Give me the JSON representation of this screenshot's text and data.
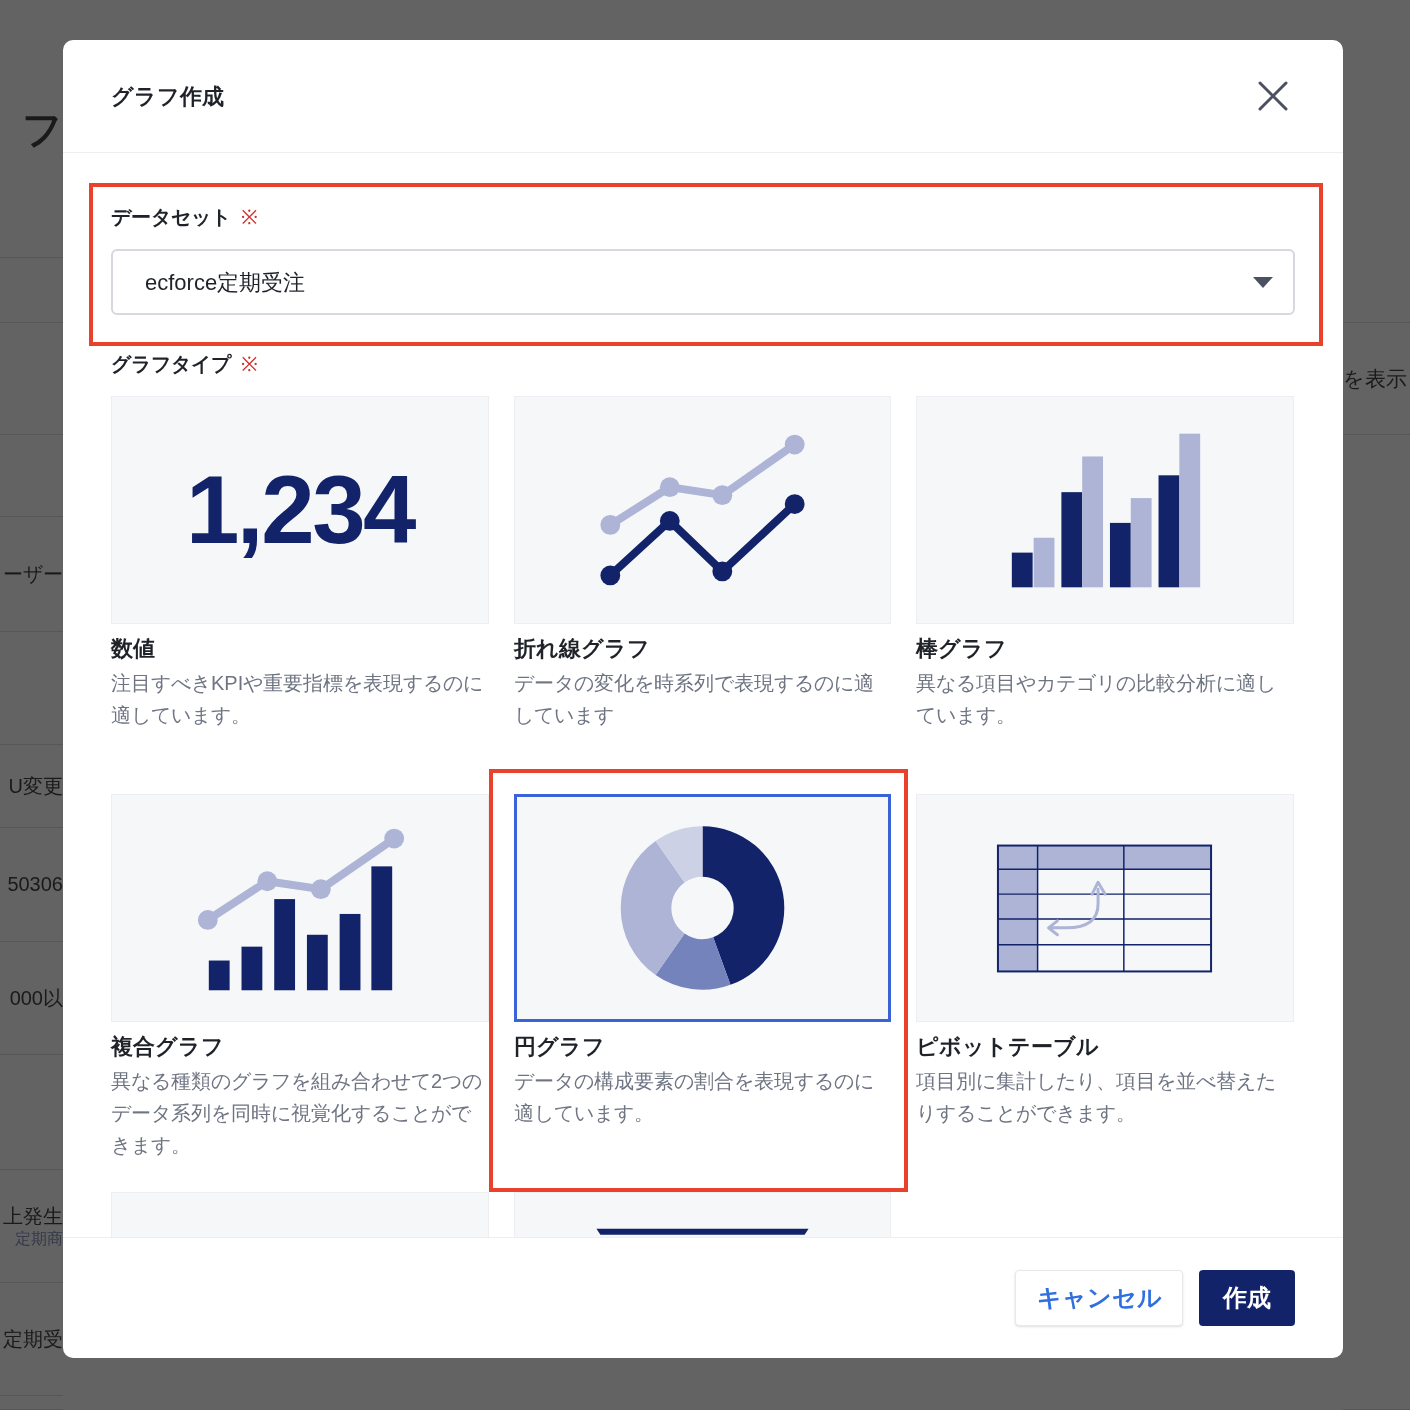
{
  "background": {
    "left": [
      {
        "text": "フ"
      },
      {
        "text": "ーザー"
      },
      {
        "text": "U変更"
      },
      {
        "text": "50306"
      },
      {
        "text": "000以"
      },
      {
        "text": "上発生",
        "subtext": "定期商"
      },
      {
        "text": "定期受"
      }
    ],
    "right": [
      "を表示"
    ]
  },
  "dialog": {
    "title": "グラフ作成"
  },
  "dataset": {
    "label": "データセット",
    "required_mark": "※",
    "value": "ecforce定期受注",
    "highlighted": true
  },
  "graph_type": {
    "label": "グラフタイプ",
    "required_mark": "※"
  },
  "cards": [
    {
      "kind": "number",
      "figure_text": "1,234",
      "title": "数値",
      "description": "注目すべきKPIや重要指標を表現するのに適しています。",
      "selected": false,
      "highlighted": false
    },
    {
      "kind": "line",
      "title": "折れ線グラフ",
      "description": "データの変化を時系列で表現するのに適しています",
      "selected": false,
      "highlighted": false
    },
    {
      "kind": "bar",
      "title": "棒グラフ",
      "description": "異なる項目やカテゴリの比較分析に適しています。",
      "selected": false,
      "highlighted": false
    },
    {
      "kind": "combo",
      "title": "複合グラフ",
      "description": "異なる種類のグラフを組み合わせて2つのデータ系列を同時に視覚化することができます。",
      "selected": false,
      "highlighted": false
    },
    {
      "kind": "pie",
      "title": "円グラフ",
      "description": "データの構成要素の割合を表現するのに適しています。",
      "selected": true,
      "highlighted": true
    },
    {
      "kind": "pivot",
      "title": "ピボットテーブル",
      "description": "項目別に集計したり、項目を並べ替えたりすることができます。",
      "selected": false,
      "highlighted": false
    },
    {
      "kind": "blank",
      "selected": false,
      "highlighted": false
    },
    {
      "kind": "bar-top",
      "selected": false,
      "highlighted": false
    }
  ],
  "buttons": {
    "cancel": "キャンセル",
    "create": "作成"
  }
}
